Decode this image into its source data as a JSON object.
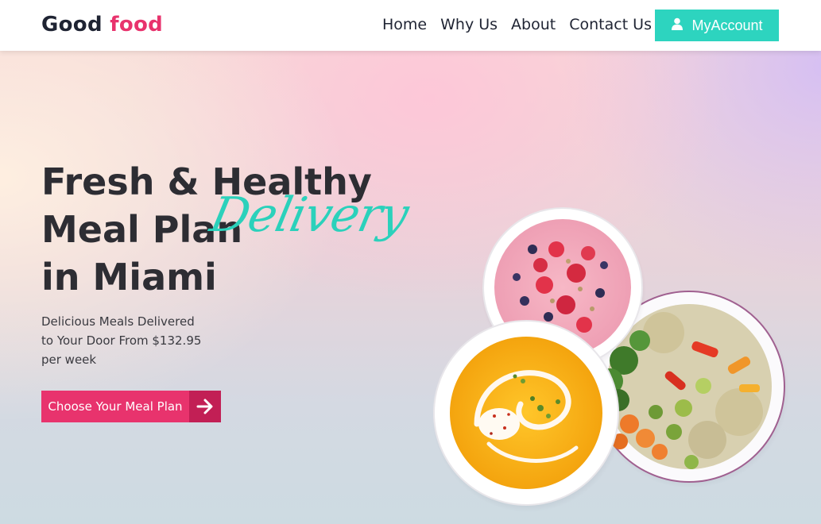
{
  "header": {
    "logo_word1": "Good",
    "logo_word2": "food",
    "nav": [
      "Home",
      "Why Us",
      "About",
      "Contact Us"
    ],
    "account_label": "MyAccount"
  },
  "hero": {
    "headline_line1": "Fresh & Healthy",
    "headline_line2": "Meal Plan",
    "headline_script": "Delivery",
    "headline_line3": "in Miami",
    "subtext_line1": "Delicious Meals Delivered",
    "subtext_line2": "to Your Door From $132.95",
    "subtext_line3": "per week",
    "cta_label": "Choose Your Meal Plan"
  },
  "icons": {
    "account": "user-icon",
    "cta": "arrow-right-icon"
  },
  "colors": {
    "accent_teal": "#2dd4bf",
    "brand_pink": "#e8336d",
    "text_dark": "#1f2433"
  }
}
